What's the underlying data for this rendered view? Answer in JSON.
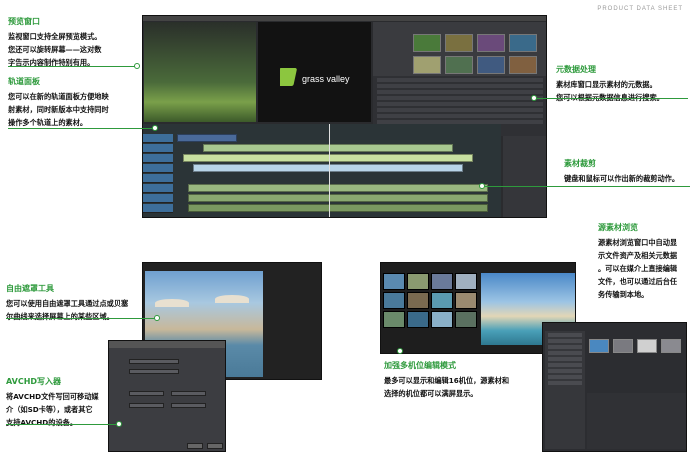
{
  "header": {
    "label": "PRODUCT DATA SHEET"
  },
  "callouts": {
    "preview": {
      "title": "预览窗口",
      "lines": [
        "监视窗口支持全屏预览模式。",
        "您还可以旋转屏幕——这对数",
        "字告示内容制作特别有用。"
      ]
    },
    "track": {
      "title": "轨道面板",
      "lines": [
        "您可以在新的轨道面板方便地映",
        "射素材，同时新版本中支持同时",
        "操作多个轨道上的素材。"
      ]
    },
    "metadata": {
      "title": "元数据处理",
      "lines": [
        "素材库窗口显示素材的元数据。",
        "您可以根据元数据信息进行搜索。"
      ]
    },
    "trim": {
      "title": "素材裁剪",
      "lines": [
        "键盘和鼠标可以作出新的裁剪动作。"
      ]
    },
    "browser": {
      "title": "源素材浏览",
      "lines": [
        "源素材浏览窗口中自动显",
        "示文件资产及相关元数据",
        "。可以在媒介上直接编辑",
        "文件，也可以通过后台任",
        "务传输到本地。"
      ]
    },
    "mask": {
      "title": "自由遮罩工具",
      "lines": [
        "您可以使用自由遮罩工具通过点或贝塞",
        "尔曲线来选择屏幕上的某些区域。"
      ]
    },
    "avchd": {
      "title": "AVCHD写入器",
      "lines": [
        "将AVCHD文件写回可移动媒",
        "介（如SD卡等），或者其它",
        "支持AVCHD的设备。"
      ]
    },
    "multicam": {
      "title": "加强多机位编辑模式",
      "lines": [
        "最多可以显示和编辑16机位，源素材和",
        "选择的机位都可以满屏显示。"
      ]
    }
  },
  "screenshots": {
    "logo_text": "grass valley"
  },
  "colors": {
    "accent": "#2e9a3c"
  }
}
